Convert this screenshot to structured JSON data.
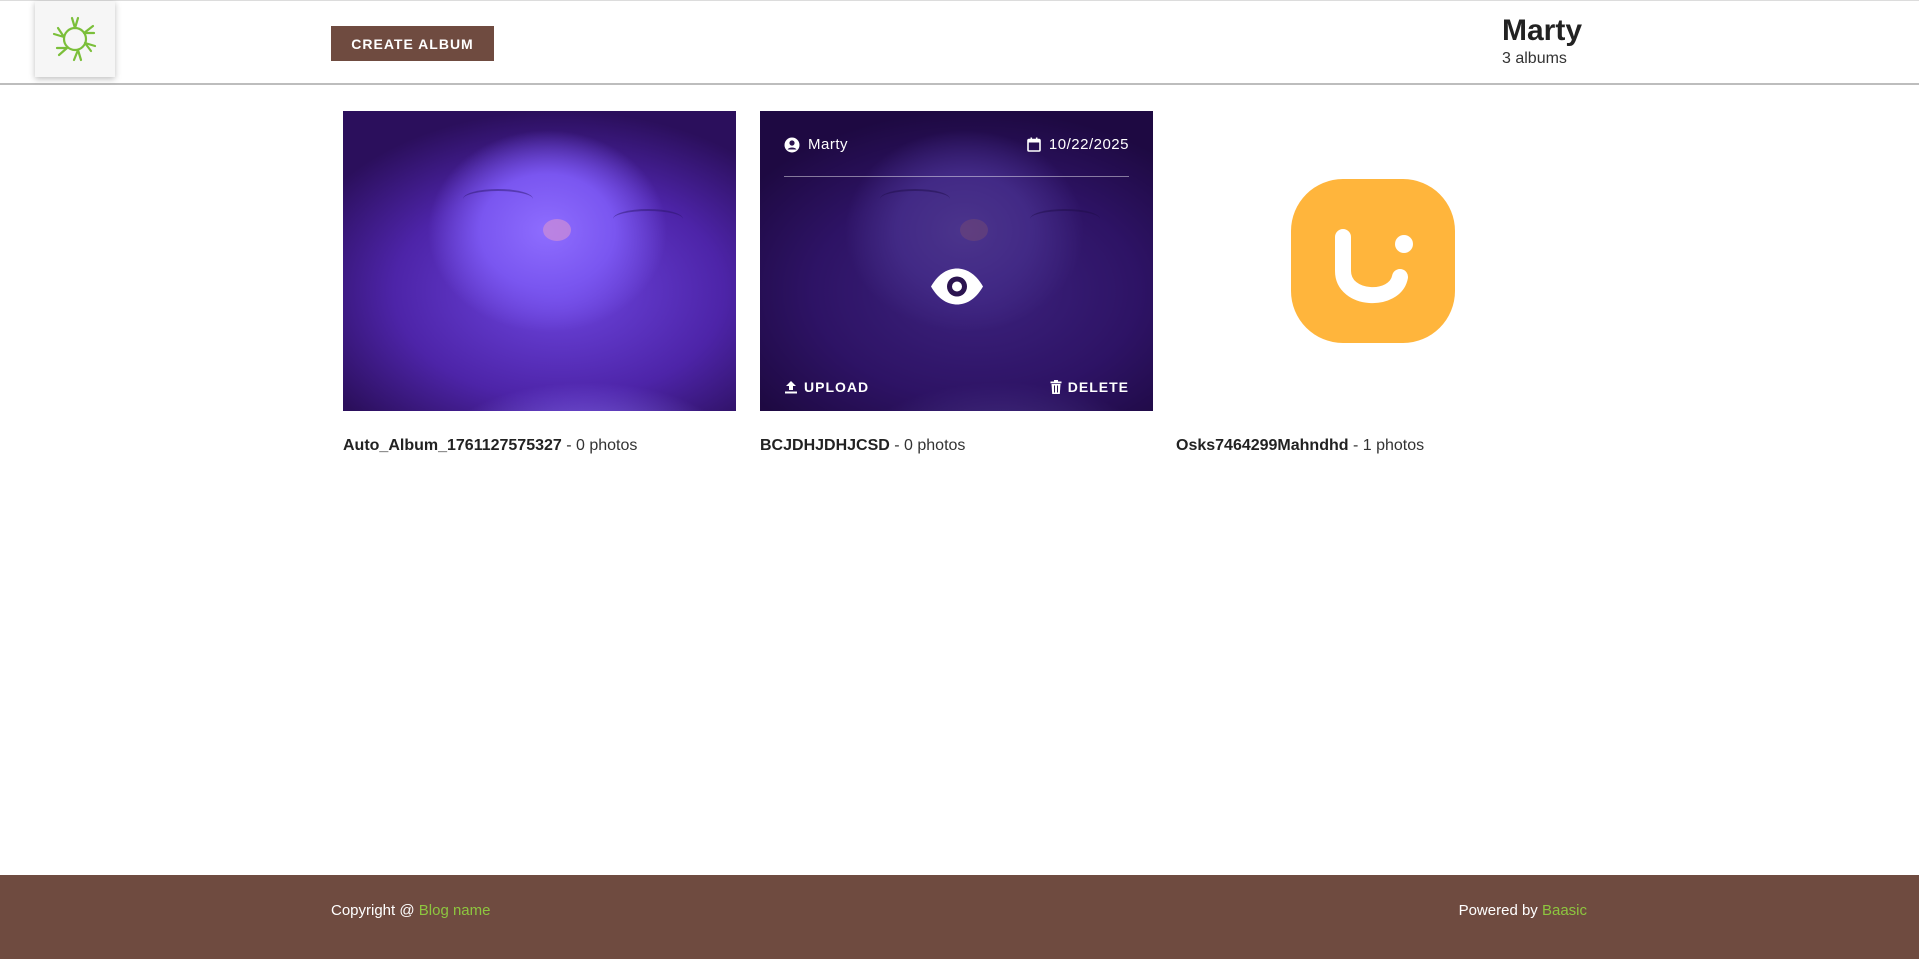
{
  "header": {
    "create_label": "CREATE ALBUM",
    "user_name": "Marty",
    "album_count": "3 albums"
  },
  "albums": [
    {
      "name": "Auto_Album_1761127575327",
      "photos": " - 0 photos",
      "image": "cat-photo"
    },
    {
      "name": "BCJDHJDHJCSD",
      "photos": " - 0 photos",
      "image": "cat-photo",
      "overlay": {
        "author": "Marty",
        "date": "10/22/2025",
        "upload_label": "UPLOAD",
        "delete_label": "DELETE",
        "view_icon": "eye-icon"
      }
    },
    {
      "name": "Osks7464299Mahndhd",
      "photos": " - 1 photos",
      "image": "placeholder-smile-logo"
    }
  ],
  "footer": {
    "copyright_prefix": "Copyright @ ",
    "copyright_link": "Blog name",
    "powered_prefix": "Powered by ",
    "powered_link": "Baasic"
  },
  "colors": {
    "brand_brown": "#6f4b40",
    "accent_green": "#8dc63f",
    "placeholder_orange": "#ffb53c"
  }
}
